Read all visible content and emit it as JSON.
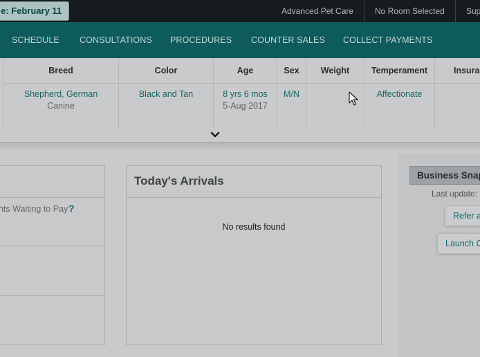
{
  "topbar": {
    "date_label": "e: February 11",
    "items": [
      "Advanced Pet Care",
      "No Room Selected",
      "Sup"
    ]
  },
  "nav": {
    "items": [
      "SCHEDULE",
      "CONSULTATIONS",
      "PROCEDURES",
      "COUNTER SALES",
      "COLLECT PAYMENTS"
    ]
  },
  "patient": {
    "headers": [
      "Breed",
      "Color",
      "Age",
      "Sex",
      "Weight",
      "Temperament",
      "Insura"
    ],
    "breed": "Shepherd, German",
    "species": "Canine",
    "color": "Black and Tan",
    "age": "8 yrs 6 mos",
    "birthdate": "5-Aug 2017",
    "sex": "M/N",
    "weight": "",
    "temperament": "Affectionate",
    "insurance": ""
  },
  "left_panel": {
    "waiting_text": "nts Waiting to Pay",
    "help": "?"
  },
  "arrivals": {
    "title": "Today's Arrivals",
    "empty_text": "No results found"
  },
  "business": {
    "title": "Business Snap",
    "last_update": "Last update:",
    "refer_label": "Refer a",
    "launch_label": "Launch C"
  },
  "icons": {
    "expand": "chevron-down-icon",
    "cursor": "mouse-pointer-icon"
  },
  "colors": {
    "topbar": "#161b1e",
    "nav": "#0e5b5b",
    "link": "#1a6565",
    "overlay_background": "#c9cacb"
  }
}
